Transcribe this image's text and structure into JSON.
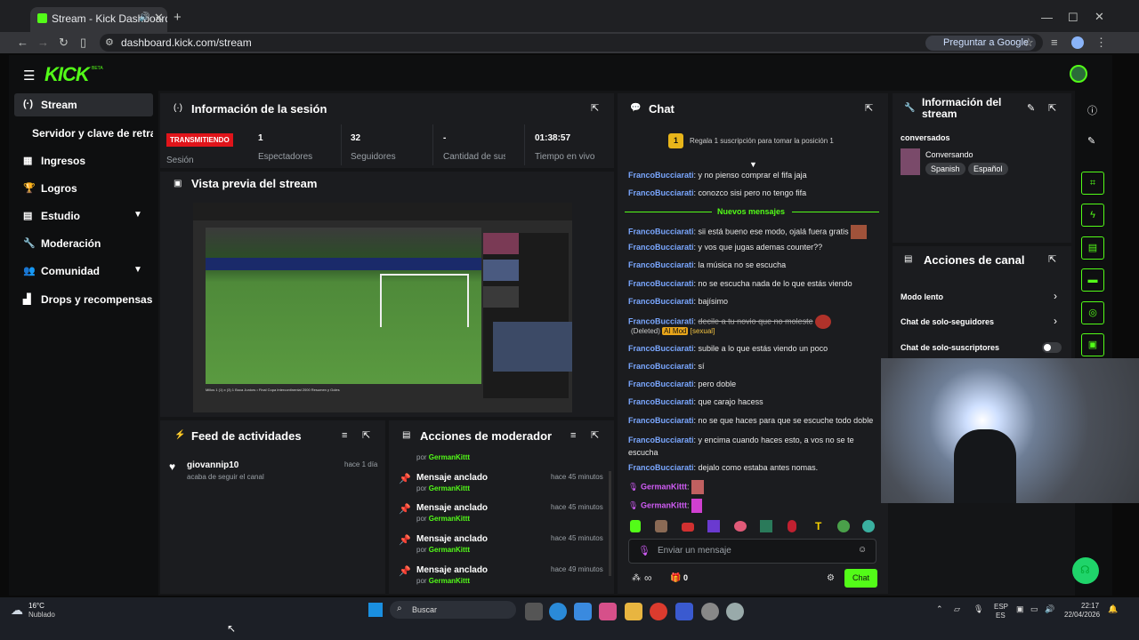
{
  "browser": {
    "tab_title": "Stream - Kick Dashboard",
    "url": "dashboard.kick.com/stream",
    "ask_google": "Preguntar a Google"
  },
  "app": {
    "logo": "KICK",
    "logo_badge": "BETA",
    "accent": "#53fc18"
  },
  "sidebar": {
    "items": [
      {
        "label": "Stream",
        "icon": "broadcast-icon"
      },
      {
        "label": "Servidor y clave de retransmisión",
        "icon": ""
      },
      {
        "label": "Ingresos",
        "icon": "revenue-icon"
      },
      {
        "label": "Logros",
        "icon": "trophy-icon"
      },
      {
        "label": "Estudio",
        "icon": "studio-icon"
      },
      {
        "label": "Moderación",
        "icon": "wrench-icon"
      },
      {
        "label": "Comunidad",
        "icon": "community-icon"
      },
      {
        "label": "Drops y recompensas",
        "icon": "drops-icon"
      }
    ]
  },
  "session": {
    "title": "Información de la sesión",
    "live_badge": "TRANSMITIENDO",
    "session_label": "Sesión",
    "stats": [
      {
        "value": "1",
        "label": "Espectadores"
      },
      {
        "value": "32",
        "label": "Seguidores"
      },
      {
        "value": "-",
        "label": "Cantidad de suscriptores"
      },
      {
        "value": "01:38:57",
        "label": "Tiempo en vivo"
      }
    ]
  },
  "preview": {
    "title": "Vista previa del stream",
    "video_caption": "Millos 1 (1) x (3) 1 Boca Juniors • Final Copa Intercontinental 2000 Resumen y Goles"
  },
  "activity": {
    "title": "Feed de actividades",
    "items": [
      {
        "user": "giovannip10",
        "text": "acaba de seguir el canal",
        "time": "hace 1 día"
      }
    ]
  },
  "mod_actions": {
    "title": "Acciones de moderador",
    "top_by": "por",
    "top_user": "GermanKittt",
    "items": [
      {
        "action": "Mensaje anclado",
        "by": "por",
        "user": "GermanKittt",
        "time": "hace 45 minutos"
      },
      {
        "action": "Mensaje anclado",
        "by": "por",
        "user": "GermanKittt",
        "time": "hace 45 minutos"
      },
      {
        "action": "Mensaje anclado",
        "by": "por",
        "user": "GermanKittt",
        "time": "hace 45 minutos"
      },
      {
        "action": "Mensaje anclado",
        "by": "por",
        "user": "GermanKittt",
        "time": "hace 49 minutos"
      }
    ]
  },
  "chat": {
    "title": "Chat",
    "gift_rank": "1",
    "gift_text": "Regala 1 suscripción para tomar la posición 1",
    "new_messages": "Nuevos mensajes",
    "messages_before": [
      {
        "user": "FrancoBucciarati",
        "text": "y no pienso comprar el fifa jaja"
      },
      {
        "user": "FrancoBucciarati",
        "text": "conozco sisi pero no tengo fifa"
      }
    ],
    "messages_after": [
      {
        "user": "FrancoBucciarati",
        "text": "sii está bueno ese modo, ojalá fuera gratis"
      },
      {
        "user": "FrancoBucciarati",
        "text": "y vos que jugas ademas counter??"
      },
      {
        "user": "FrancoBucciarati",
        "text": "la música no se escucha"
      },
      {
        "user": "FrancoBucciarati",
        "text": "no se escucha nada de lo que estás viendo"
      },
      {
        "user": "FrancoBucciarati",
        "text": "bajísimo"
      }
    ],
    "deleted": {
      "user": "FrancoBucciarati",
      "text": "decile a tu novio que no moleste",
      "tag": "(Deleted)",
      "mod_badge": "AI Mod",
      "reason": "[sexual]"
    },
    "messages_tail": [
      {
        "user": "FrancoBucciarati",
        "text": "subile a lo que estás viendo un poco"
      },
      {
        "user": "FrancoBucciarati",
        "text": "sí"
      },
      {
        "user": "FrancoBucciarati",
        "text": "pero doble"
      },
      {
        "user": "FrancoBucciarati",
        "text": "que carajo hacess"
      },
      {
        "user": "FrancoBucciarati",
        "text": "no se que haces para que se escuche todo doble"
      },
      {
        "user": "FrancoBucciarati",
        "text": "y encima cuando haces esto, a vos no se te escucha"
      },
      {
        "user": "FrancoBucciarati",
        "text": "dejalo como estaba antes nomas."
      }
    ],
    "mod_messages": [
      {
        "user": "GermanKittt"
      },
      {
        "user": "GermanKittt"
      }
    ],
    "input_placeholder": "Enviar un mensaje",
    "infinity": "∞",
    "points": "0",
    "send_label": "Chat"
  },
  "stream_info": {
    "title": "Información del stream",
    "stream_title": "conversados",
    "category": "Conversando",
    "tags": [
      "Spanish",
      "Español"
    ]
  },
  "channel_actions": {
    "title": "Acciones de canal",
    "items": [
      {
        "label": "Modo lento"
      },
      {
        "label": "Chat de solo-seguidores"
      },
      {
        "label": "Chat de solo-suscriptores"
      }
    ]
  },
  "taskbar": {
    "temp": "16°C",
    "weather": "Nublado",
    "search": "Buscar",
    "lang": "ESP",
    "lang2": "ES",
    "time": "22:17",
    "date": "22/04/2026"
  }
}
